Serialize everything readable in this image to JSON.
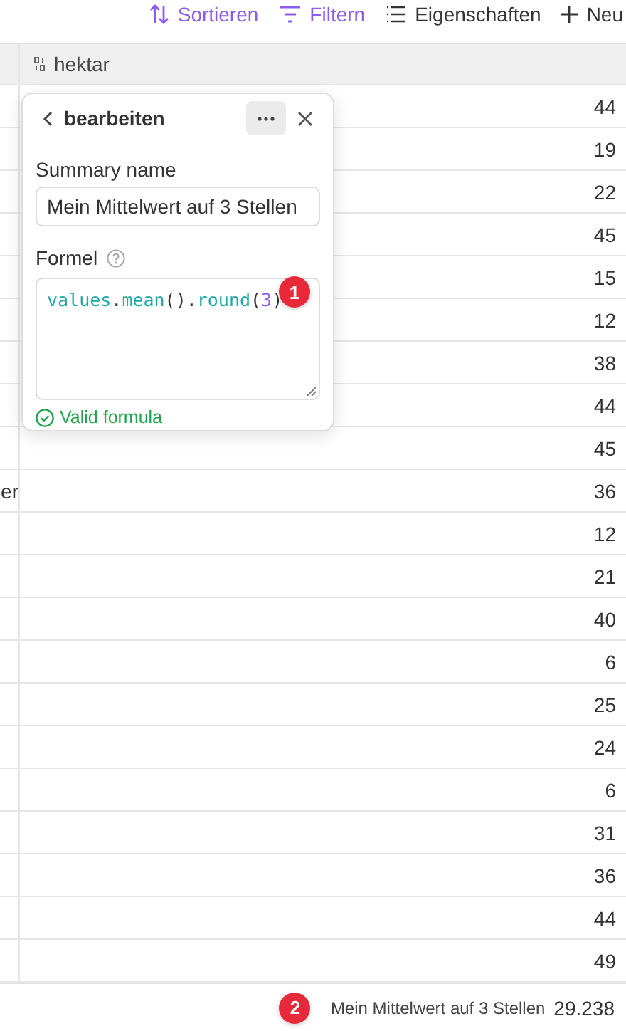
{
  "toolbar": [
    {
      "kind": "sort",
      "label": "Sortieren",
      "active": true
    },
    {
      "kind": "filter",
      "label": "Filtern",
      "active": true
    },
    {
      "kind": "properties",
      "label": "Eigenschaften",
      "active": false
    },
    {
      "kind": "new",
      "label": "Neu",
      "active": false
    }
  ],
  "table": {
    "columns": [
      {
        "label": "hektar"
      }
    ],
    "rows": [
      {
        "hektar": "44"
      },
      {
        "hektar": "19"
      },
      {
        "hektar": "22"
      },
      {
        "hektar": "45"
      },
      {
        "hektar": "15"
      },
      {
        "hektar": "12"
      },
      {
        "hektar": "38"
      },
      {
        "hektar": "44"
      },
      {
        "hektar": "45"
      },
      {
        "column_1": "er",
        "hektar": "36"
      },
      {
        "hektar": "12"
      },
      {
        "hektar": "21"
      },
      {
        "hektar": "40"
      },
      {
        "hektar": "6"
      },
      {
        "hektar": "25"
      },
      {
        "hektar": "24"
      },
      {
        "hektar": "6"
      },
      {
        "hektar": "31"
      },
      {
        "hektar": "36"
      },
      {
        "hektar": "44"
      },
      {
        "hektar": "49"
      }
    ]
  },
  "popover": {
    "title": "bearbeiten",
    "name_label": "Summary name",
    "name_value": "Mein Mittelwert auf 3 Stellen",
    "formula_label": "Formel",
    "formula_tokens": [
      {
        "kind": "ident",
        "text": "values"
      },
      {
        "kind": "punct",
        "text": "."
      },
      {
        "kind": "ident",
        "text": "mean"
      },
      {
        "kind": "punct",
        "text": "()."
      },
      {
        "kind": "ident",
        "text": "round"
      },
      {
        "kind": "punct",
        "text": "("
      },
      {
        "kind": "number",
        "text": "3"
      },
      {
        "kind": "punct",
        "text": ")"
      }
    ],
    "status": "Valid formula",
    "badge": "1"
  },
  "footer": {
    "badge": "2",
    "label": "Mein Mittelwert auf 3 Stellen",
    "value": "29.238"
  }
}
